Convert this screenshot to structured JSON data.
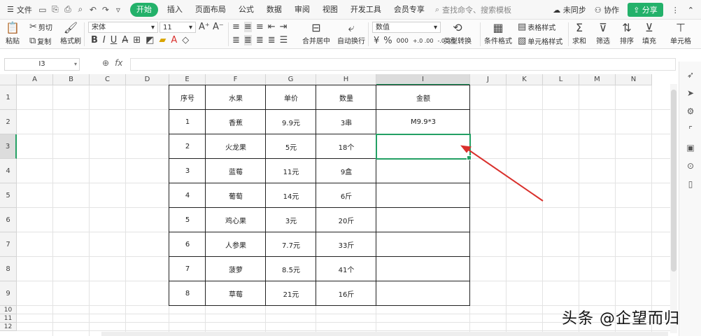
{
  "menu": {
    "file_label": "文件",
    "tabs": [
      "开始",
      "插入",
      "页面布局",
      "公式",
      "数据",
      "审阅",
      "视图",
      "开发工具",
      "会员专享"
    ],
    "active_tab": 0,
    "search_placeholder": "查找命令、搜索模板",
    "sync_label": "未同步",
    "collab_label": "协作",
    "share_label": "分享"
  },
  "ribbon": {
    "paste": "粘贴",
    "cut": "剪切",
    "copy": "复制",
    "format_painter": "格式刷",
    "font_name": "宋体",
    "font_size": "11",
    "merge_center": "合并居中",
    "auto_wrap": "自动换行",
    "number_format": "数值",
    "currency": "¥",
    "percent": "%",
    "thousands": "000",
    "dec_inc": "+.0 .00",
    "dec_dec": "-.0 .00",
    "type_convert": "类型转换",
    "conditional_format": "条件格式",
    "table_style": "表格样式",
    "cell_style": "单元格样式",
    "sum": "求和",
    "filter": "筛选",
    "sort": "排序",
    "fill": "填充",
    "cell": "单元格"
  },
  "formula_bar": {
    "name_box": "I3",
    "fx": "fx",
    "content": ""
  },
  "columns": [
    "A",
    "B",
    "C",
    "D",
    "E",
    "F",
    "G",
    "H",
    "I",
    "J",
    "K",
    "L",
    "M",
    "N"
  ],
  "rows": [
    "1",
    "2",
    "3",
    "4",
    "5",
    "6",
    "7",
    "8",
    "9",
    "10",
    "11",
    "12"
  ],
  "selected_column": "I",
  "selected_row": "3",
  "table": {
    "headers": [
      "序号",
      "水果",
      "单价",
      "数量",
      "金额"
    ],
    "rows": [
      [
        "1",
        "香蕉",
        "9.9元",
        "3串",
        "M9.9*3"
      ],
      [
        "2",
        "火龙果",
        "5元",
        "18个",
        ""
      ],
      [
        "3",
        "蓝莓",
        "11元",
        "9盒",
        ""
      ],
      [
        "4",
        "葡萄",
        "14元",
        "6斤",
        ""
      ],
      [
        "5",
        "鸡心果",
        "3元",
        "20斤",
        ""
      ],
      [
        "6",
        "人参果",
        "7.7元",
        "33斤",
        ""
      ],
      [
        "7",
        "菠萝",
        "8.5元",
        "41个",
        ""
      ],
      [
        "8",
        "草莓",
        "21元",
        "16斤",
        ""
      ]
    ]
  },
  "colors": {
    "accent": "#23b16a",
    "selection": "#23a064",
    "arrow": "#d9302c"
  },
  "watermark": "头条 @企望而归"
}
